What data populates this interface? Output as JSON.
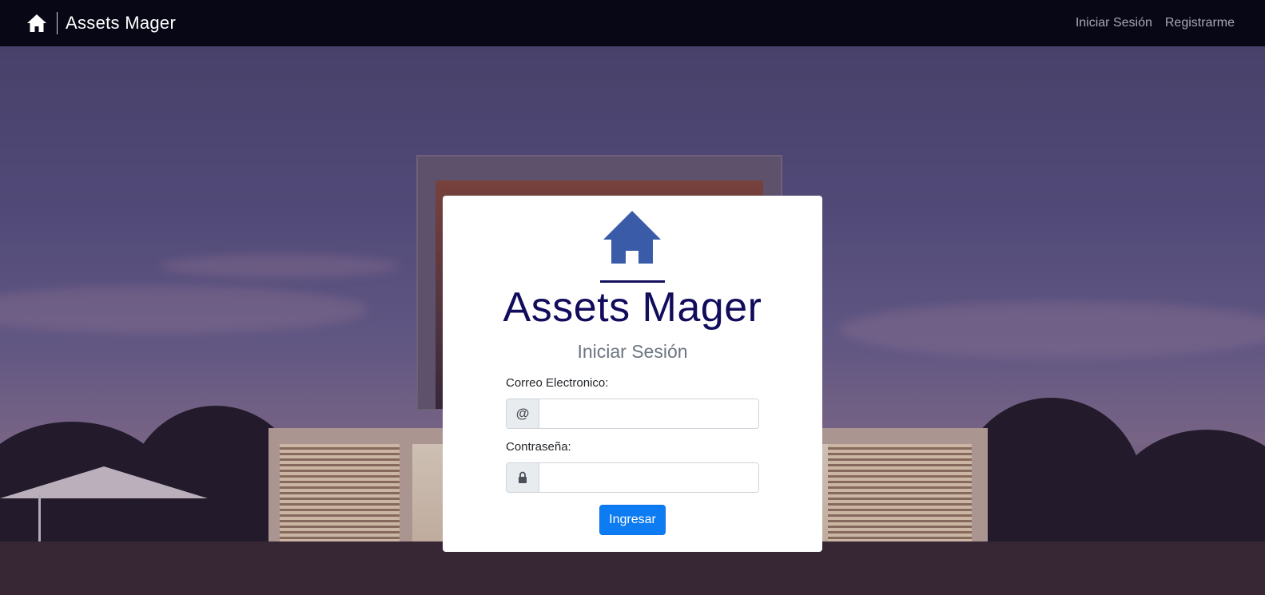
{
  "navbar": {
    "brand_icon": "home-icon",
    "brand_name": "Assets Mager",
    "links": [
      {
        "label": "Iniciar Sesión"
      },
      {
        "label": "Registrarme"
      }
    ]
  },
  "login": {
    "logo_icon": "home-icon",
    "title": "Assets Mager",
    "subtitle": "Iniciar Sesión",
    "email": {
      "label": "Correo Electronico:",
      "addon": "@",
      "value": ""
    },
    "password": {
      "label": "Contraseña:",
      "addon_icon": "lock-icon",
      "value": ""
    },
    "submit_label": "Ingresar"
  },
  "colors": {
    "navbar_bg": "#070716",
    "brand_blue": "#3a5ba8",
    "title_color": "#110c5c",
    "button_primary": "#0d7cf2"
  }
}
